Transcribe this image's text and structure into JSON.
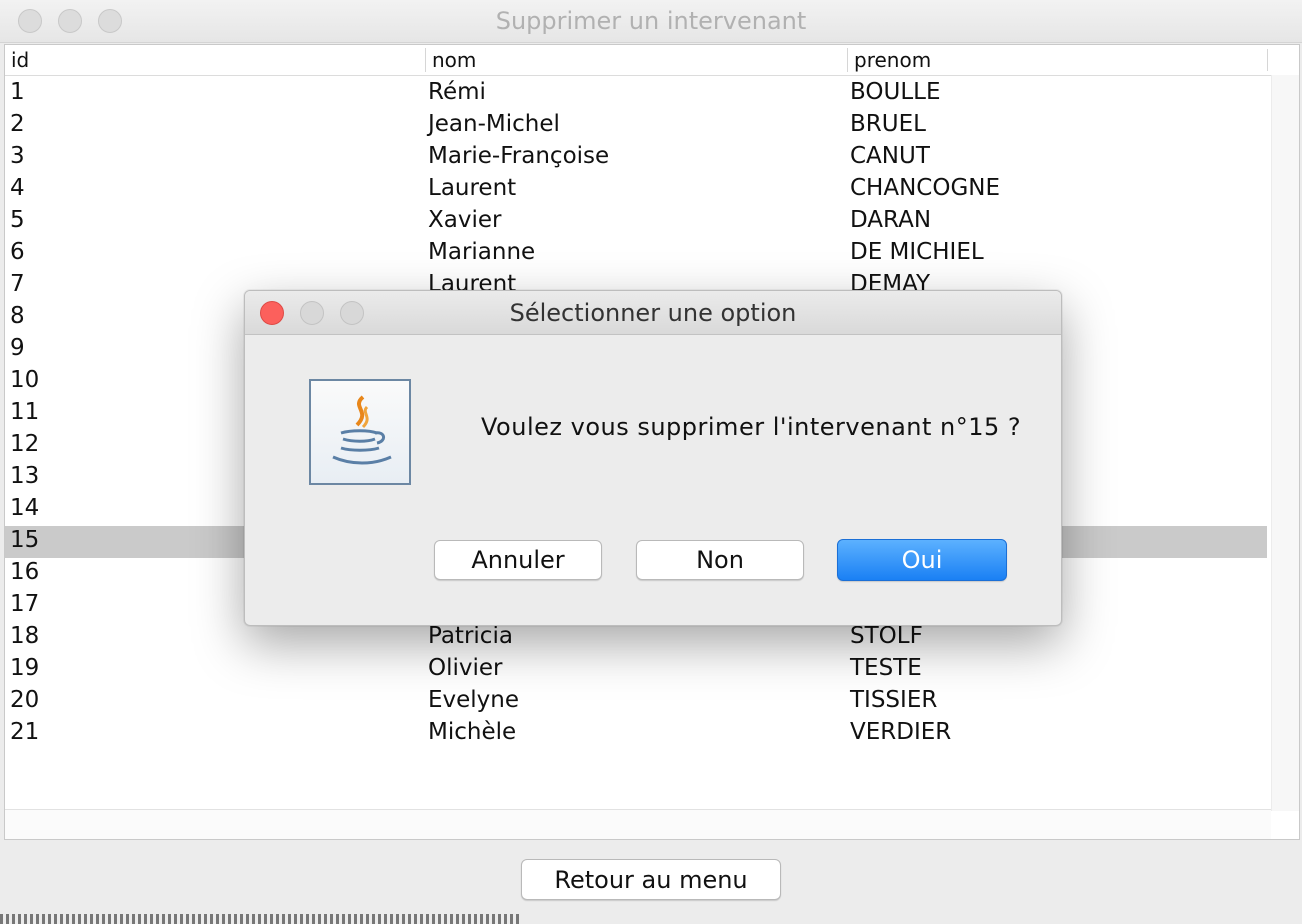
{
  "window": {
    "title": "Supprimer un intervenant"
  },
  "table": {
    "columns": [
      "id",
      "nom",
      "prenom"
    ],
    "rows": [
      {
        "id": "1",
        "nom": "Rémi",
        "prenom": "BOULLE"
      },
      {
        "id": "2",
        "nom": "Jean-Michel",
        "prenom": "BRUEL"
      },
      {
        "id": "3",
        "nom": "Marie-Françoise",
        "prenom": "CANUT"
      },
      {
        "id": "4",
        "nom": "Laurent",
        "prenom": "CHANCOGNE"
      },
      {
        "id": "5",
        "nom": "Xavier",
        "prenom": "DARAN"
      },
      {
        "id": "6",
        "nom": "Marianne",
        "prenom": "DE MICHIEL"
      },
      {
        "id": "7",
        "nom": "Laurent",
        "prenom": "DEMAY"
      },
      {
        "id": "8",
        "nom": "",
        "prenom": ""
      },
      {
        "id": "9",
        "nom": "",
        "prenom": ""
      },
      {
        "id": "10",
        "nom": "",
        "prenom": ""
      },
      {
        "id": "11",
        "nom": "",
        "prenom": ""
      },
      {
        "id": "12",
        "nom": "",
        "prenom": ""
      },
      {
        "id": "13",
        "nom": "",
        "prenom": ""
      },
      {
        "id": "14",
        "nom": "",
        "prenom": ""
      },
      {
        "id": "15",
        "nom": "",
        "prenom": ""
      },
      {
        "id": "16",
        "nom": "",
        "prenom": ""
      },
      {
        "id": "17",
        "nom": "",
        "prenom": ""
      },
      {
        "id": "18",
        "nom": "Patricia",
        "prenom": "STOLF"
      },
      {
        "id": "19",
        "nom": "Olivier",
        "prenom": "TESTE"
      },
      {
        "id": "20",
        "nom": "Evelyne",
        "prenom": "TISSIER"
      },
      {
        "id": "21",
        "nom": "Michèle",
        "prenom": "VERDIER"
      }
    ],
    "selected_row_id": "15"
  },
  "footer": {
    "retour_label": "Retour au menu"
  },
  "dialog": {
    "title": "Sélectionner une option",
    "message": "Voulez vous supprimer l'intervenant n°15 ?",
    "icon": "java-coffee-icon",
    "buttons": {
      "annuler": "Annuler",
      "non": "Non",
      "oui": "Oui"
    }
  },
  "colors": {
    "close_button": "#fc605c",
    "default_button": "#1a80f4",
    "selected_row": "#cacaca"
  }
}
